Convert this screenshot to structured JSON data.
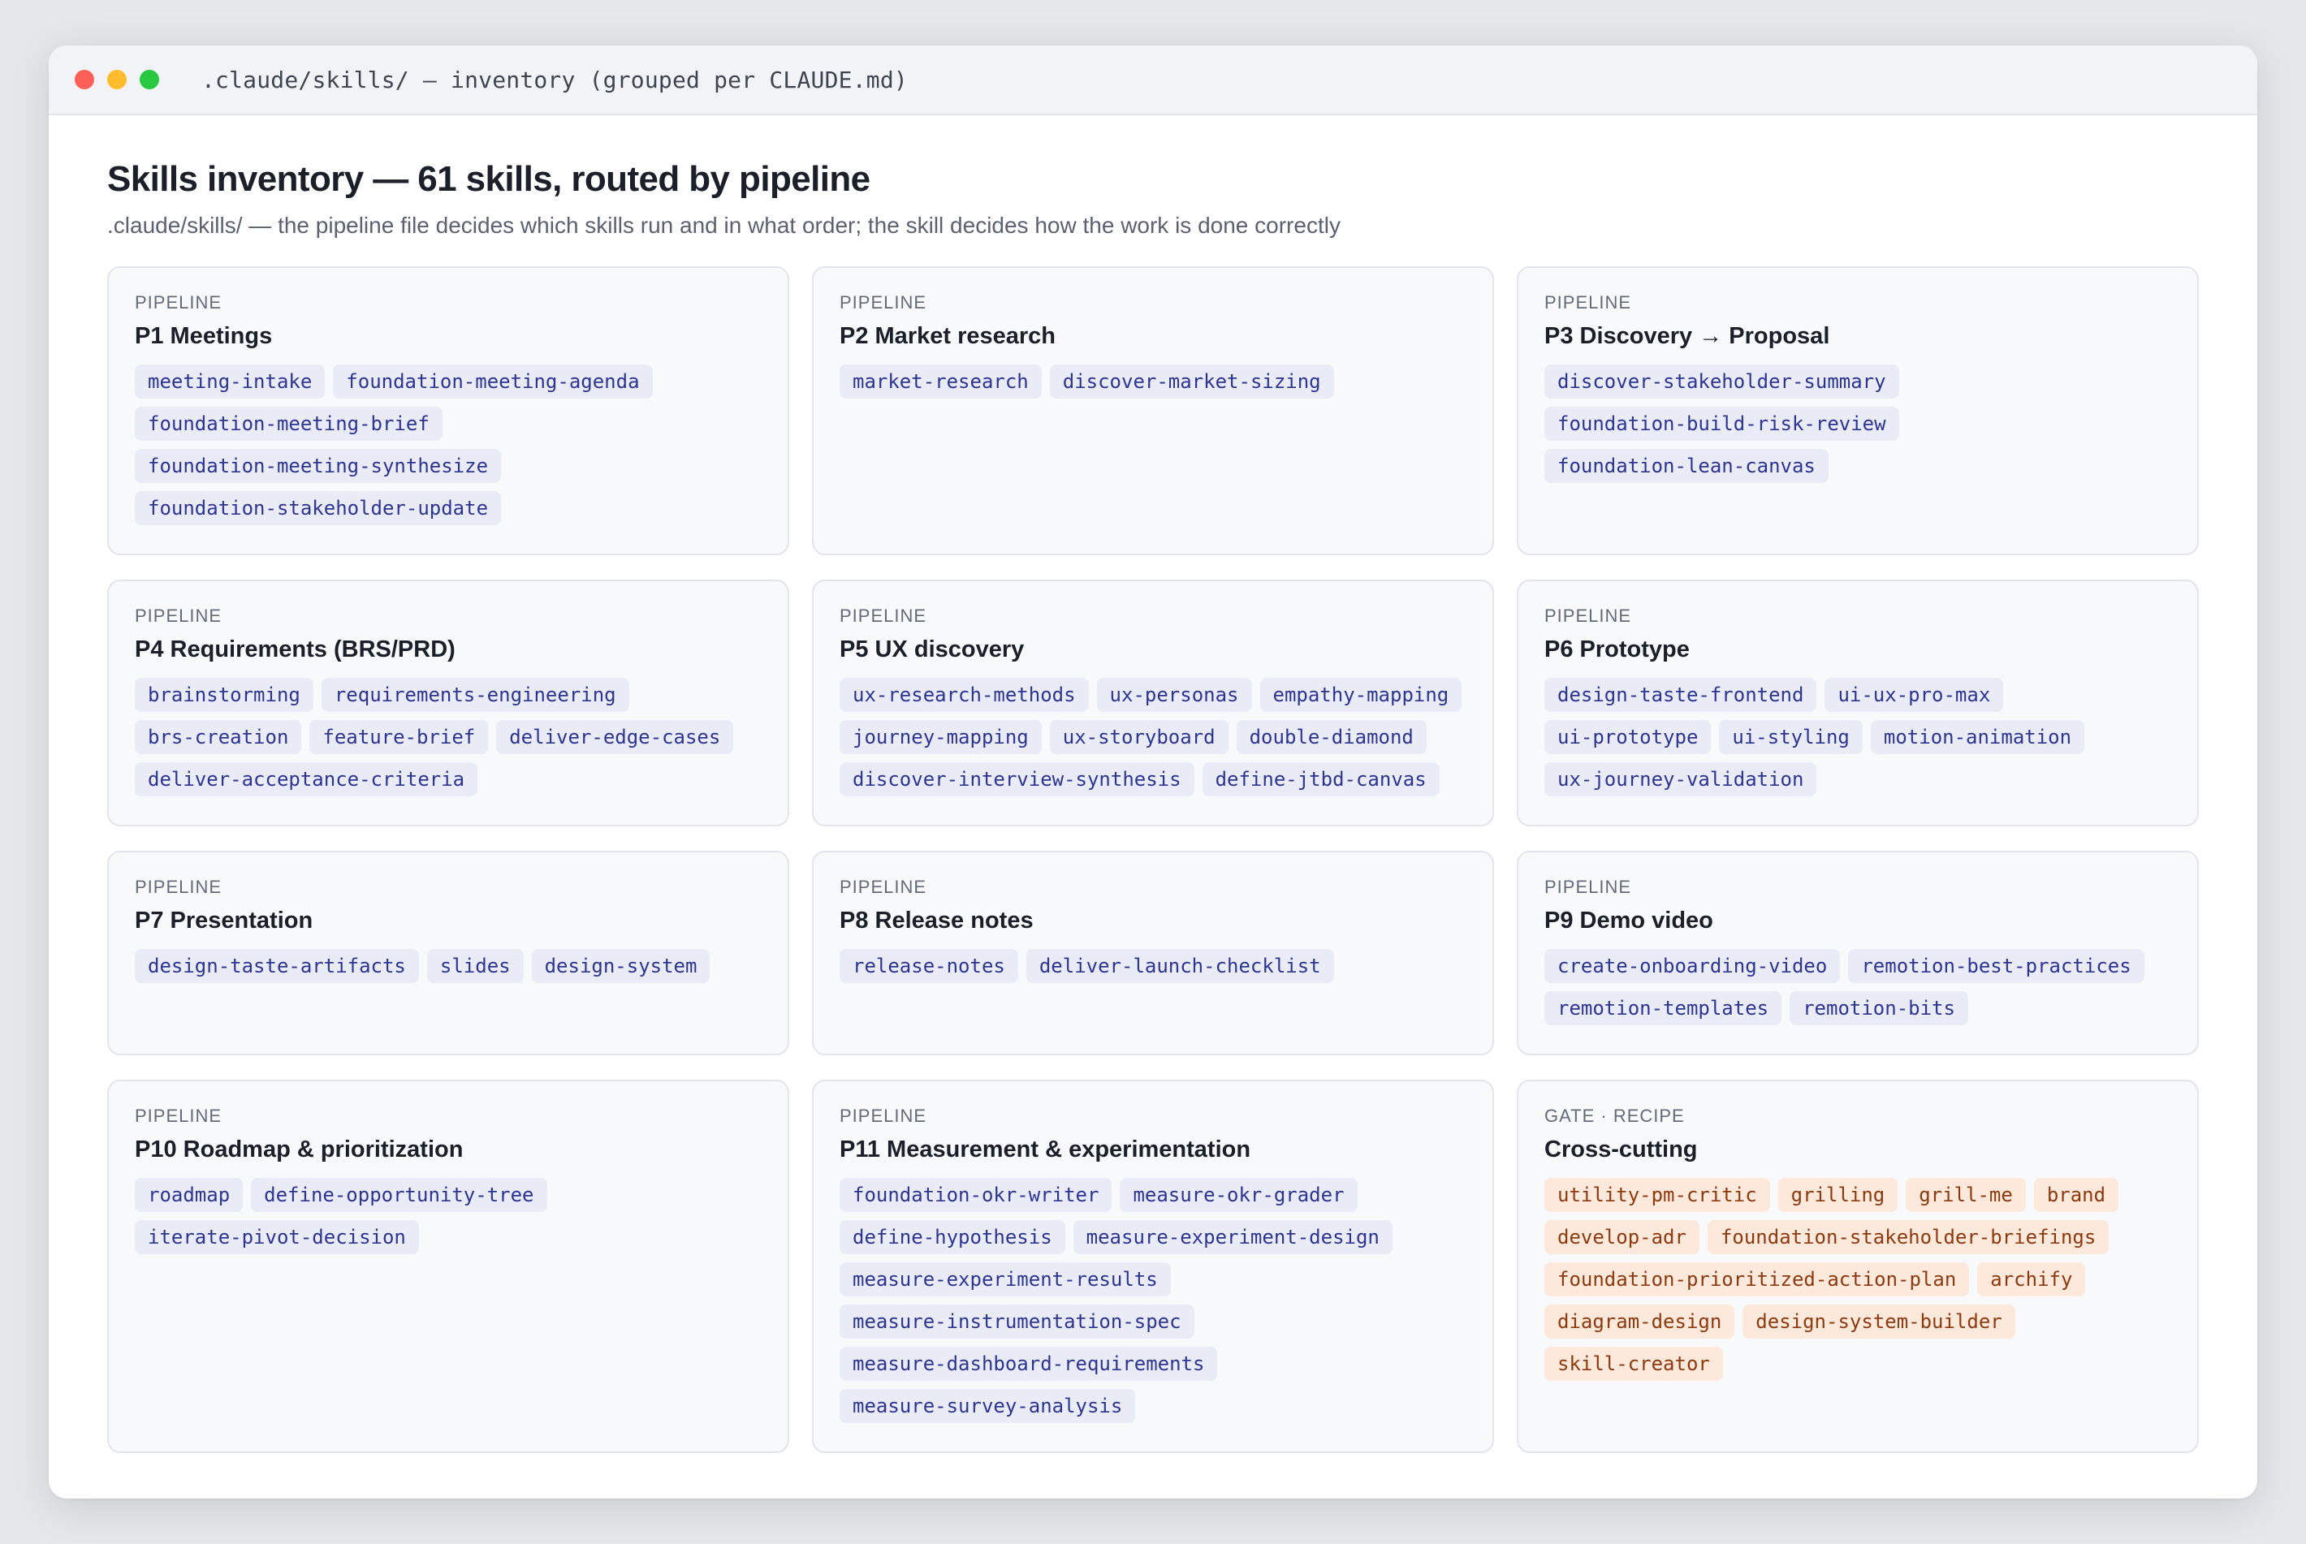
{
  "window": {
    "title": ".claude/skills/ — inventory (grouped per CLAUDE.md)",
    "traffic_lights": {
      "close_color": "#fe5f57",
      "minimize_color": "#febc2e",
      "zoom_color": "#28c840"
    }
  },
  "header": {
    "title": "Skills inventory — 61 skills, routed by pipeline",
    "subtitle": ".claude/skills/ — the pipeline file decides which skills run and in what order; the skill decides how the work is done correctly"
  },
  "colors": {
    "pipeline_chip_bg": "#e9ebf7",
    "pipeline_chip_text": "#2e3590",
    "crosscutting_chip_bg": "#fde8dc",
    "crosscutting_chip_text": "#8d3a0e"
  },
  "cards": [
    {
      "label": "PIPELINE",
      "title": "P1 Meetings",
      "skills": [
        "meeting-intake",
        "foundation-meeting-agenda",
        "foundation-meeting-brief",
        "foundation-meeting-synthesize",
        "foundation-stakeholder-update"
      ]
    },
    {
      "label": "PIPELINE",
      "title": "P2 Market research",
      "skills": [
        "market-research",
        "discover-market-sizing"
      ]
    },
    {
      "label": "PIPELINE",
      "title": "P3 Discovery → Proposal",
      "skills": [
        "discover-stakeholder-summary",
        "foundation-build-risk-review",
        "foundation-lean-canvas"
      ]
    },
    {
      "label": "PIPELINE",
      "title": "P4 Requirements (BRS/PRD)",
      "skills": [
        "brainstorming",
        "requirements-engineering",
        "brs-creation",
        "feature-brief",
        "deliver-edge-cases",
        "deliver-acceptance-criteria"
      ]
    },
    {
      "label": "PIPELINE",
      "title": "P5 UX discovery",
      "skills": [
        "ux-research-methods",
        "ux-personas",
        "empathy-mapping",
        "journey-mapping",
        "ux-storyboard",
        "double-diamond",
        "discover-interview-synthesis",
        "define-jtbd-canvas"
      ]
    },
    {
      "label": "PIPELINE",
      "title": "P6 Prototype",
      "skills": [
        "design-taste-frontend",
        "ui-ux-pro-max",
        "ui-prototype",
        "ui-styling",
        "motion-animation",
        "ux-journey-validation"
      ]
    },
    {
      "label": "PIPELINE",
      "title": "P7 Presentation",
      "skills": [
        "design-taste-artifacts",
        "slides",
        "design-system"
      ]
    },
    {
      "label": "PIPELINE",
      "title": "P8 Release notes",
      "skills": [
        "release-notes",
        "deliver-launch-checklist"
      ]
    },
    {
      "label": "PIPELINE",
      "title": "P9 Demo video",
      "skills": [
        "create-onboarding-video",
        "remotion-best-practices",
        "remotion-templates",
        "remotion-bits"
      ]
    },
    {
      "label": "PIPELINE",
      "title": "P10 Roadmap & prioritization",
      "skills": [
        "roadmap",
        "define-opportunity-tree",
        "iterate-pivot-decision"
      ]
    },
    {
      "label": "PIPELINE",
      "title": "P11 Measurement & experimentation",
      "skills": [
        "foundation-okr-writer",
        "measure-okr-grader",
        "define-hypothesis",
        "measure-experiment-design",
        "measure-experiment-results",
        "measure-instrumentation-spec",
        "measure-dashboard-requirements",
        "measure-survey-analysis"
      ]
    },
    {
      "label": "GATE · RECIPE",
      "title": "Cross-cutting",
      "variant": "orange",
      "skills": [
        "utility-pm-critic",
        "grilling",
        "grill-me",
        "brand",
        "develop-adr",
        "foundation-stakeholder-briefings",
        "foundation-prioritized-action-plan",
        "archify",
        "diagram-design",
        "design-system-builder",
        "skill-creator"
      ]
    }
  ]
}
